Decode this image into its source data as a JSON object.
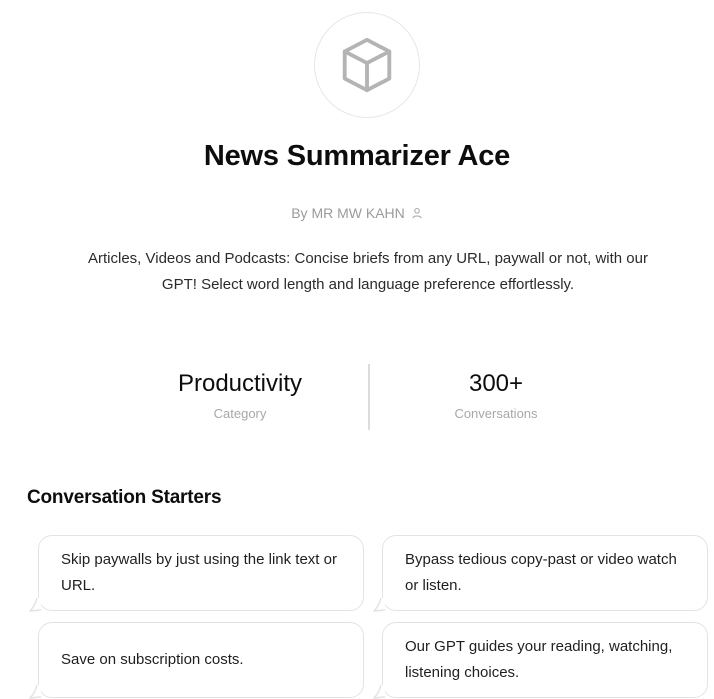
{
  "gpt": {
    "icon": "cube-icon",
    "name": "News Summarizer Ace",
    "author": "By MR MW KAHN",
    "author_icon": "person-icon",
    "description": "Articles, Videos and Podcasts: Concise briefs from any URL, paywall or not, with our GPT! Select word length and language preference effortlessly."
  },
  "stats": {
    "category_value": "Productivity",
    "category_label": "Category",
    "conversations_value": "300+",
    "conversations_label": "Conversations"
  },
  "starters": {
    "heading": "Conversation Starters",
    "items": [
      "Skip paywalls by just using the link text or URL.",
      "Bypass tedious copy-past or video watch or listen.",
      "Save on subscription costs.",
      "Our GPT guides your reading, watching, listening choices."
    ]
  },
  "colors": {
    "text": "#0d0d0d",
    "muted": "#9b9b9b",
    "border": "#e3e3e3"
  }
}
